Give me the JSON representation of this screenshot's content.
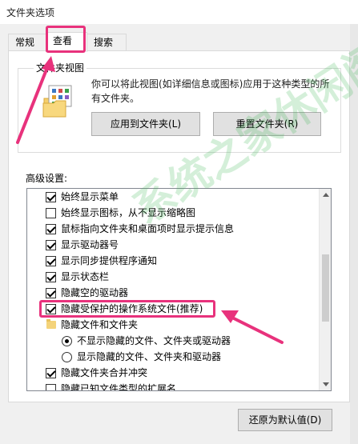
{
  "window": {
    "title": "文件夹选项"
  },
  "tabs": [
    {
      "label": "常规"
    },
    {
      "label": "查看"
    },
    {
      "label": "搜索"
    }
  ],
  "folder_views": {
    "legend": "文件夹视图",
    "description": "你可以将此视图(如详细信息或图标)应用于这种类型的所有文件夹。",
    "apply_button": "应用到文件夹(L)",
    "reset_button": "重置文件夹(R)"
  },
  "advanced": {
    "label": "高级设置:",
    "items": [
      {
        "type": "checkbox",
        "checked": true,
        "label": "始终显示菜单"
      },
      {
        "type": "checkbox",
        "checked": false,
        "label": "始终显示图标，从不显示缩略图"
      },
      {
        "type": "checkbox",
        "checked": true,
        "label": "鼠标指向文件夹和桌面项时显示提示信息"
      },
      {
        "type": "checkbox",
        "checked": true,
        "label": "显示驱动器号"
      },
      {
        "type": "checkbox",
        "checked": true,
        "label": "显示同步提供程序通知"
      },
      {
        "type": "checkbox",
        "checked": true,
        "label": "显示状态栏"
      },
      {
        "type": "checkbox",
        "checked": true,
        "label": "隐藏空的驱动器"
      },
      {
        "type": "checkbox",
        "checked": true,
        "label": "隐藏受保护的操作系统文件(推荐)"
      },
      {
        "type": "folder",
        "label": "隐藏文件和文件夹"
      },
      {
        "type": "radio",
        "selected": true,
        "label": "不显示隐藏的文件、文件夹或驱动器"
      },
      {
        "type": "radio",
        "selected": false,
        "label": "显示隐藏的文件、文件夹和驱动器"
      },
      {
        "type": "checkbox",
        "checked": true,
        "label": "隐藏文件夹合并冲突"
      },
      {
        "type": "checkbox",
        "checked": false,
        "label": "隐藏已知文件类型的扩展名"
      }
    ]
  },
  "restore_button": "还原为默认值(D)",
  "watermark": "系统之家休闲阁",
  "colors": {
    "highlight": "#e8327c",
    "accent": "#0078d7"
  }
}
